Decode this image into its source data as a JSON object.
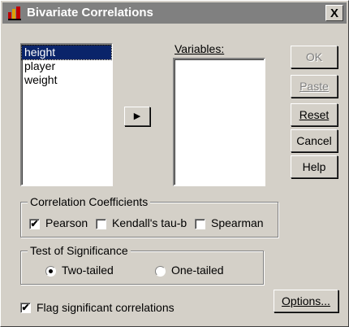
{
  "window": {
    "title": "Bivariate Correlations",
    "close_label": "X"
  },
  "source_list": {
    "items": [
      "height",
      "player",
      "weight"
    ],
    "selected": "height"
  },
  "variables": {
    "label": "Variables:"
  },
  "buttons": {
    "ok": "OK",
    "paste": "Paste",
    "reset": "Reset",
    "cancel": "Cancel",
    "help": "Help",
    "options": "Options..."
  },
  "coefficients": {
    "title": "Correlation Coefficients",
    "pearson": {
      "label": "Pearson",
      "checked": true
    },
    "kendall": {
      "label": "Kendall's tau-b",
      "checked": false
    },
    "spearman": {
      "label": "Spearman",
      "checked": false
    }
  },
  "significance": {
    "title": "Test of Significance",
    "two_tailed": {
      "label": "Two-tailed",
      "selected": true
    },
    "one_tailed": {
      "label": "One-tailed",
      "selected": false
    }
  },
  "flag": {
    "label": "Flag significant correlations",
    "checked": true
  },
  "icons": {
    "title": "spss-app-icon",
    "arrow": "right-arrow-icon",
    "check": "✔"
  }
}
